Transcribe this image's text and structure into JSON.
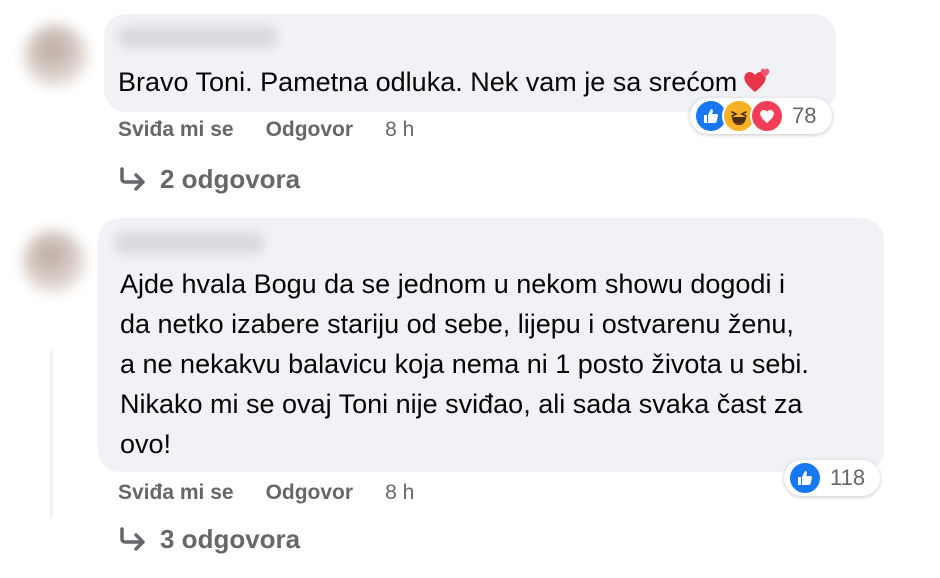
{
  "comments": [
    {
      "text": "Bravo Toni. Pametna odluka. Nek vam je sa srećom",
      "trailing_emoji": "two-hearts-icon",
      "reactions": [
        "like-icon",
        "haha-icon",
        "love-icon"
      ],
      "reaction_count": "78",
      "actions": {
        "like": "Sviđa mi se",
        "reply": "Odgovor",
        "time": "8 h"
      },
      "replies_label": "2 odgovora"
    },
    {
      "text": "Ajde hvala Bogu da se jednom u nekom showu dogodi i\nda netko izabere stariju od sebe, lijepu i ostvarenu ženu,\na ne nekakvu balavicu koja nema ni 1 posto života u sebi.\nNikako mi se ovaj Toni nije sviđao, ali sada svaka čast za\novo!",
      "reactions": [
        "like-icon"
      ],
      "reaction_count": "118",
      "actions": {
        "like": "Sviđa mi se",
        "reply": "Odgovor",
        "time": "8 h"
      },
      "replies_label": "3 odgovora"
    }
  ],
  "colors": {
    "bubble": "#f0f2f5",
    "secondary_text": "#65676b",
    "like": "#1877f2",
    "haha": "#f7b125",
    "love": "#f33e58"
  }
}
